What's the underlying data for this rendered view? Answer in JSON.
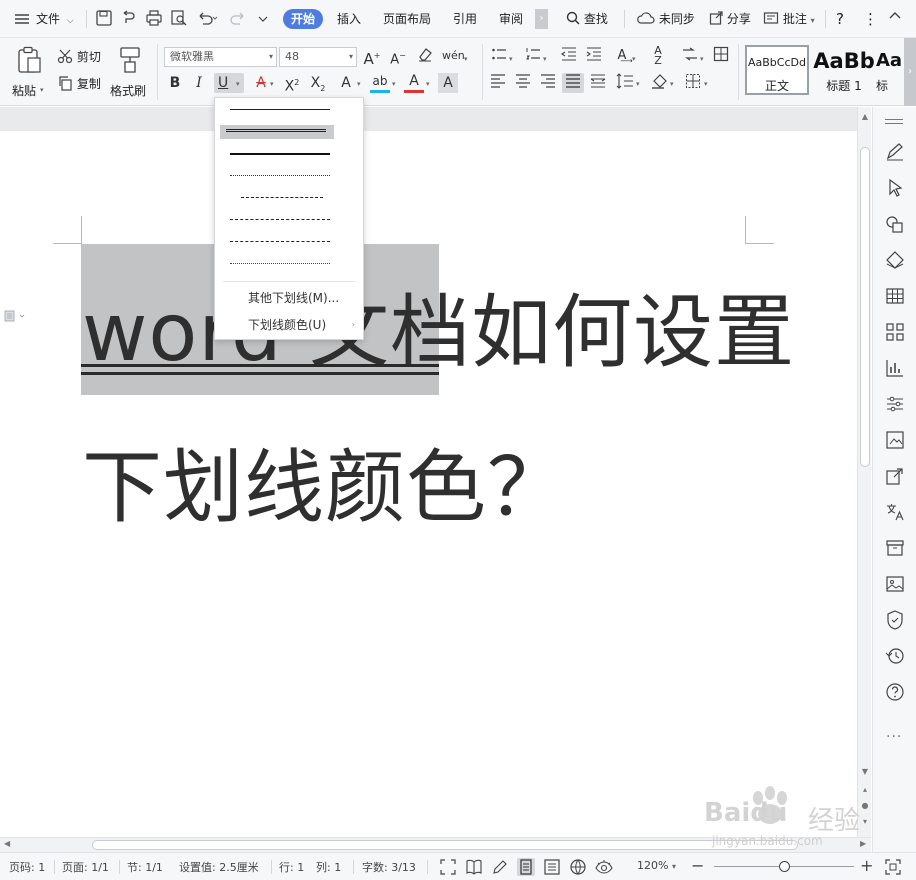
{
  "menubar": {
    "file_label": "文件",
    "tabs": [
      "开始",
      "插入",
      "页面布局",
      "引用",
      "审阅"
    ],
    "active_tab": "开始",
    "find_label": "查找",
    "sync_label": "未同步",
    "share_label": "分享",
    "comment_label": "批注"
  },
  "ribbon": {
    "paste_label": "粘贴",
    "cut_label": "剪切",
    "copy_label": "复制",
    "format_painter_label": "格式刷",
    "font_name": "微软雅黑",
    "font_size": "48",
    "styles": [
      {
        "sample": "AaBbCcDd",
        "caption": "正文"
      },
      {
        "sample": "AaBb",
        "caption": "标题 1"
      },
      {
        "sample": "Aa",
        "caption": "标"
      }
    ]
  },
  "underline_menu": {
    "styles": [
      "single",
      "double",
      "thick",
      "dotted",
      "dashed",
      "dash-dot",
      "dash-dot-dot",
      "wave"
    ],
    "selected_style": "double",
    "more_label": "其他下划线(M)...",
    "color_label": "下划线颜色(U)"
  },
  "document": {
    "line1": "word 文档如何设置",
    "line2": "下划线颜色？",
    "selected_text": "word 文档"
  },
  "statusbar": {
    "page_num": "页码: 1",
    "page": "页面: 1/1",
    "section": "节: 1/1",
    "setting": "设置值: 2.5厘米",
    "row": "行: 1",
    "col": "列: 1",
    "word_count": "字数: 3/13",
    "zoom": "120%",
    "zoom_fraction": 0.5
  },
  "watermark": {
    "brand": "Baidu",
    "brand_cn": "经验",
    "url": "jingyan.baidu.com"
  }
}
